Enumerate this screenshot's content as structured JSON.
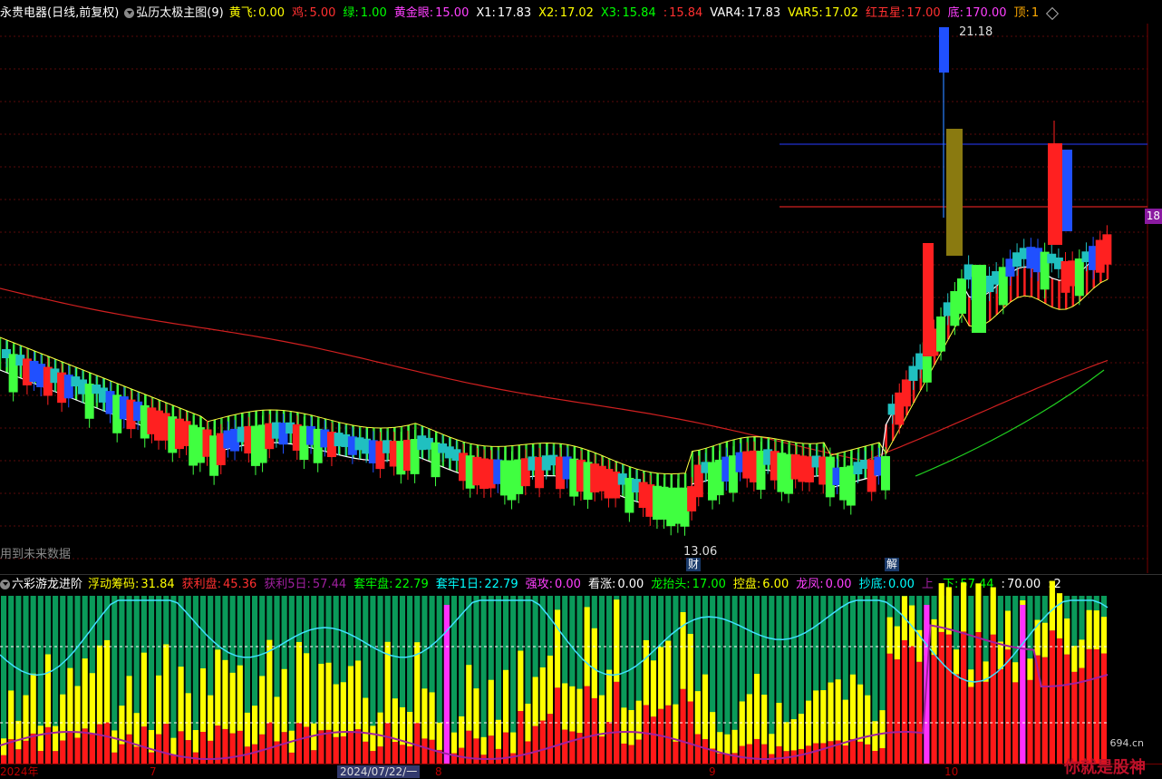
{
  "top_indicator": {
    "stock": "永贵电器(日线,前复权)",
    "study": "弘历太极主图(9)",
    "items": [
      {
        "label": "黄飞:",
        "value": "0.00",
        "color": "#ffff00"
      },
      {
        "label": "鸡:",
        "value": "5.00",
        "color": "#ff3030"
      },
      {
        "label": "绿:",
        "value": "1.00",
        "color": "#00ff00"
      },
      {
        "label": "黄金眼:",
        "value": "15.00",
        "color": "#ff40ff"
      },
      {
        "label": "X1:",
        "value": "17.83",
        "color": "#ffffff"
      },
      {
        "label": "X2:",
        "value": "17.02",
        "color": "#ffff00"
      },
      {
        "label": "X3:",
        "value": "15.84",
        "color": "#00ff00"
      },
      {
        "label": ":",
        "value": "15.84",
        "color": "#ff3030"
      },
      {
        "label": "VAR4:",
        "value": "17.83",
        "color": "#ffffff"
      },
      {
        "label": "VAR5:",
        "value": "17.02",
        "color": "#ffff00"
      },
      {
        "label": "红五星:",
        "value": "17.00",
        "color": "#ff3030"
      },
      {
        "label": "底:",
        "value": "170.00",
        "color": "#ff40ff"
      },
      {
        "label": "顶:",
        "value": "1",
        "color": "#ffaa00"
      }
    ]
  },
  "price_labels": {
    "high": "21.18",
    "low": "13.06",
    "side": "18"
  },
  "tags": {
    "cai": "财",
    "jie": "解"
  },
  "note": "用到未来数据",
  "mid_indicator": {
    "study": "六彩游龙进阶",
    "items": [
      {
        "label": "浮动筹码:",
        "value": "31.84",
        "color": "#ffff00"
      },
      {
        "label": "获利盘:",
        "value": "45.36",
        "color": "#ff3030"
      },
      {
        "label": "获利5日:",
        "value": "57.44",
        "color": "#a020a0"
      },
      {
        "label": "套牢盘:",
        "value": "22.79",
        "color": "#00ff00"
      },
      {
        "label": "套牢1日:",
        "value": "22.79",
        "color": "#00ffff"
      },
      {
        "label": "强攻:",
        "value": "0.00",
        "color": "#ff40ff"
      },
      {
        "label": "看涨:",
        "value": "0.00",
        "color": "#ffffff"
      },
      {
        "label": "龙抬头:",
        "value": "17.00",
        "color": "#00ff00"
      },
      {
        "label": "控盘:",
        "value": "6.00",
        "color": "#ffff00"
      },
      {
        "label": "龙凤:",
        "value": "0.00",
        "color": "#ff40ff"
      },
      {
        "label": "抄底:",
        "value": "0.00",
        "color": "#00ffff"
      },
      {
        "label": "上",
        "value": "",
        "color": "#a020a0"
      },
      {
        "label": "下:",
        "value": "57.44",
        "color": "#00ff00"
      },
      {
        "label": ":",
        "value": "70.00",
        "color": "#ffffff"
      },
      {
        "label": ":",
        "value": "2",
        "color": "#ffffff"
      }
    ]
  },
  "date_axis": {
    "labels": [
      "2024年",
      "7",
      "2024/07/22/一",
      "8",
      "9",
      "10"
    ]
  },
  "watermark": {
    "main": "你就是股神",
    "sub": "694.cn"
  },
  "colors": {
    "up": "#ff2020",
    "down_cyan": "#20c0c0",
    "down_blue": "#2050ff",
    "green": "#40ff40",
    "yellow": "#ffff00"
  }
}
